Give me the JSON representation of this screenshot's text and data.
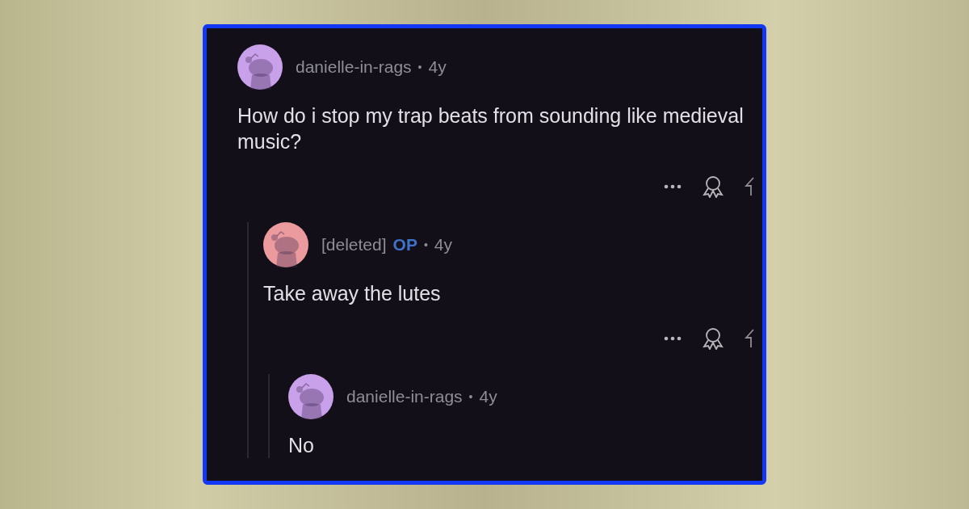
{
  "comments": [
    {
      "author": "danielle-in-rags",
      "separator": "•",
      "time": "4y",
      "color": "#c9a0ea",
      "body": "How do i stop my trap beats from sounding like medieval music?",
      "actions": true,
      "children": [
        {
          "author": "[deleted]",
          "badge": "OP",
          "separator": "•",
          "time": "4y",
          "color": "#eb9a9e",
          "body": "Take away the lutes",
          "actions": true,
          "children": [
            {
              "author": "danielle-in-rags",
              "separator": "•",
              "time": "4y",
              "color": "#c9a0ea",
              "body": "No",
              "actions": false
            }
          ]
        }
      ]
    }
  ]
}
